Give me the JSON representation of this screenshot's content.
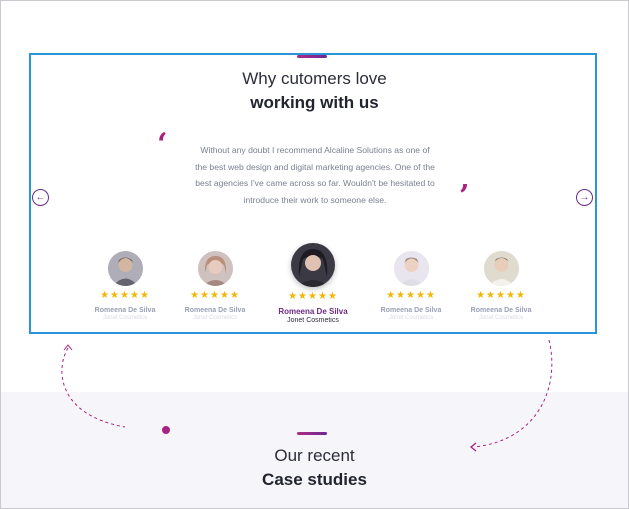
{
  "testimonials_section": {
    "title_light": "Why cutomers love",
    "title_bold": "working with us",
    "quote": "Without any doubt I recommend Alcaline Solutions as one of the best web design and digital marketing agencies. One of the best agencies I've came across so far. Wouldn't be hesitated to introduce their work to someone else.",
    "quote_open_glyph": "‘",
    "quote_close_glyph": "’",
    "prev_arrow": "←",
    "next_arrow": "→",
    "reviewers": [
      {
        "name": "Romeena De Silva",
        "company": "Jonet Cosmetics",
        "stars": "★★★★★",
        "active": false
      },
      {
        "name": "Romeena De Silva",
        "company": "Jonet Cosmetics",
        "stars": "★★★★★",
        "active": false
      },
      {
        "name": "Romeena De Silva",
        "company": "Jonet Cosmetics",
        "stars": "★★★★★",
        "active": true
      },
      {
        "name": "Romeena De Silva",
        "company": "Jonet Cosmetics",
        "stars": "★★★★★",
        "active": false
      },
      {
        "name": "Romeena De Silva",
        "company": "Jonet Cosmetics",
        "stars": "★★★★★",
        "active": false
      }
    ],
    "rating_stars": 5
  },
  "case_studies_section": {
    "title_light": "Our recent",
    "title_bold": "Case studies"
  },
  "colors": {
    "accent_magenta": "#a8237f",
    "accent_purple": "#6e2b86",
    "selection_blue": "#2a95d8",
    "star_gold": "#f2b705",
    "band_bg": "#f6f5fa"
  },
  "icons": {
    "prev": "arrow-left-icon",
    "next": "arrow-right-icon",
    "star": "star-icon"
  }
}
